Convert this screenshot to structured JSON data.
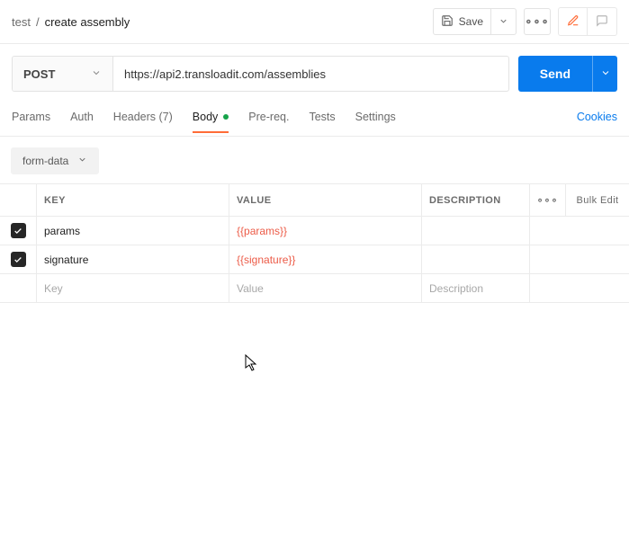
{
  "breadcrumb": {
    "collection": "test",
    "sep": "/",
    "name": "create assembly"
  },
  "topbar": {
    "save": "Save"
  },
  "request": {
    "method": "POST",
    "url": "https://api2.transloadit.com/assemblies",
    "send": "Send"
  },
  "tabs": {
    "params": "Params",
    "auth": "Auth",
    "headers": "Headers (7)",
    "body": "Body",
    "prereq": "Pre-req.",
    "tests": "Tests",
    "settings": "Settings",
    "cookies": "Cookies"
  },
  "body_type": {
    "label": "form-data"
  },
  "table": {
    "headers": {
      "key": "KEY",
      "value": "VALUE",
      "description": "DESCRIPTION",
      "bulk": "Bulk Edit"
    },
    "rows": [
      {
        "checked": true,
        "key": "params",
        "value": "{{params}}",
        "description": ""
      },
      {
        "checked": true,
        "key": "signature",
        "value": "{{signature}}",
        "description": ""
      }
    ],
    "placeholders": {
      "key": "Key",
      "value": "Value",
      "description": "Description"
    }
  }
}
